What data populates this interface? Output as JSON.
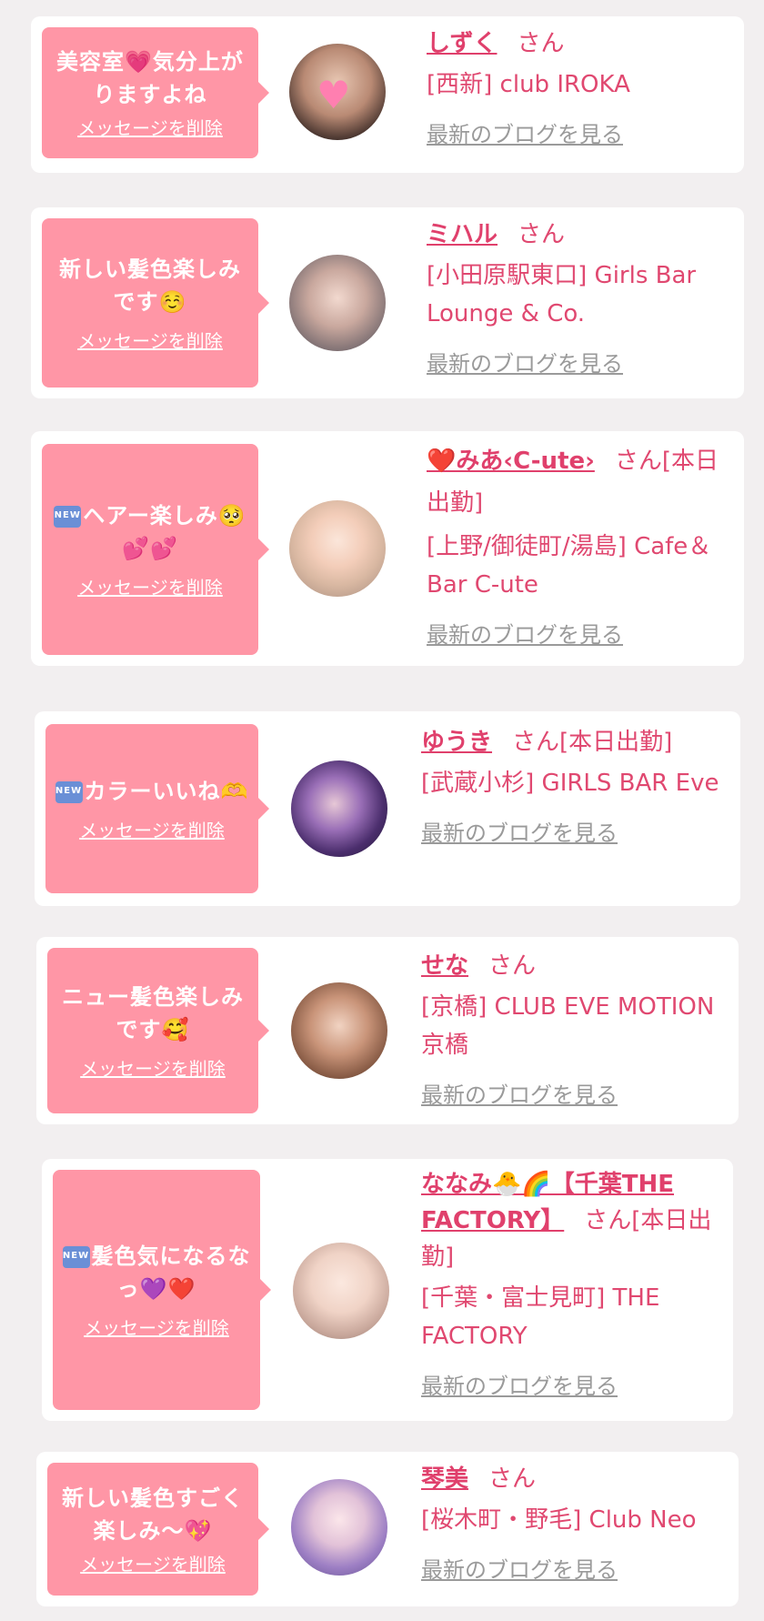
{
  "messages": [
    {
      "badge": "",
      "text": "美容室💗気分上がりますよね",
      "delete_label": "メッセージを削除",
      "name": "しずく",
      "honorific": "さん",
      "shop": "[西新] club IROKA",
      "blog_label": "最新のブログを見る"
    },
    {
      "badge": "",
      "text": "新しい髪色楽しみです☺️",
      "delete_label": "メッセージを削除",
      "name": "ミハル",
      "honorific": "さん",
      "shop": "[小田原駅東口] Girls Bar Lounge & Co.",
      "blog_label": "最新のブログを見る"
    },
    {
      "badge": "NEW",
      "text": "ヘアー楽しみ🥺💕💕",
      "delete_label": "メッセージを削除",
      "name": "❤️みあ‹C-ute›",
      "honorific": "さん[本日出勤]",
      "shop": "[上野/御徒町/湯島] Cafe＆Bar C-ute",
      "blog_label": "最新のブログを見る"
    },
    {
      "badge": "NEW",
      "text": "カラーいいね🫶",
      "delete_label": "メッセージを削除",
      "name": "ゆうき",
      "honorific": "さん[本日出勤]",
      "shop": "[武蔵小杉] GIRLS BAR Eve",
      "blog_label": "最新のブログを見る"
    },
    {
      "badge": "",
      "text": "ニュー髪色楽しみです🥰",
      "delete_label": "メッセージを削除",
      "name": "せな",
      "honorific": "さん",
      "shop": "[京橋] CLUB EVE MOTION 京橋",
      "blog_label": "最新のブログを見る"
    },
    {
      "badge": "NEW",
      "text": "髪色気になるなっ💜❤️",
      "delete_label": "メッセージを削除",
      "name": "ななみ🐣🌈【千葉THE FACTORY】",
      "honorific": "さん[本日出勤]",
      "shop": "[千葉・富士見町] THE FACTORY",
      "blog_label": "最新のブログを見る"
    },
    {
      "badge": "",
      "text": "新しい髪色すごく楽しみ〜💖",
      "delete_label": "メッセージを削除",
      "name": "琴美",
      "honorific": "さん",
      "shop": "[桜木町・野毛] Club Neo",
      "blog_label": "最新のブログを見る"
    }
  ],
  "colors": {
    "page_bg": "#f2eff0",
    "card_bg": "#ffffff",
    "bubble_bg": "#ff96a6",
    "accent_text": "#e04870",
    "link_gray": "#9a9a9a"
  }
}
